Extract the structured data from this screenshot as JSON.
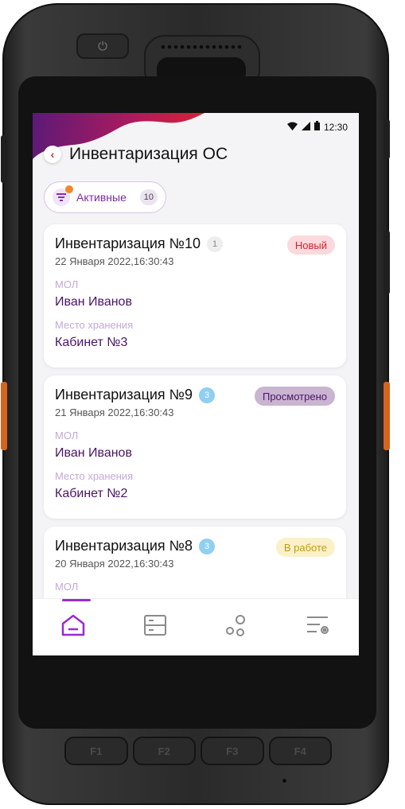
{
  "status_bar": {
    "time": "12:30"
  },
  "header": {
    "title": "Инвентаризация ОС",
    "back_icon": "chevron-left-icon"
  },
  "filter": {
    "label": "Активные",
    "count": "10",
    "icon": "filter-icon"
  },
  "field_labels": {
    "mol": "МОЛ",
    "storage": "Место хранения"
  },
  "cards": [
    {
      "title": "Инвентаризация №10",
      "count": "1",
      "date": "22 Января 2022,16:30:43",
      "status": "Новый",
      "status_bg": "#fbd9dc",
      "status_fg": "#d8222e",
      "badge_bg": "#eeeeee",
      "badge_fg": "#888888",
      "mol": "Иван Иванов",
      "storage": "Кабинет №3"
    },
    {
      "title": "Инвентаризация №9",
      "count": "3",
      "date": "21 Января 2022,16:30:43",
      "status": "Просмотрено",
      "status_bg": "#c9b4d2",
      "status_fg": "#4a1466",
      "badge_bg": "#8fcff2",
      "badge_fg": "#ffffff",
      "mol": "Иван Иванов",
      "storage": "Кабинет №2"
    },
    {
      "title": "Инвентаризация №8",
      "count": "3",
      "date": "20 Января 2022,16:30:43",
      "status": "В работе",
      "status_bg": "#fbf1c8",
      "status_fg": "#c49a1a",
      "badge_bg": "#8fcff2",
      "badge_fg": "#ffffff",
      "mol": "",
      "storage": ""
    }
  ],
  "bottom_nav": [
    {
      "icon": "home-icon",
      "active": true
    },
    {
      "icon": "list-icon",
      "active": false
    },
    {
      "icon": "circles-icon",
      "active": false
    },
    {
      "icon": "settings-list-icon",
      "active": false
    }
  ],
  "device": {
    "fkeys": [
      "F1",
      "F2",
      "F3",
      "F4"
    ]
  },
  "colors": {
    "accent": "#9b2bd0",
    "brand_red": "#e2242d",
    "brand_purple": "#5a1a78"
  }
}
